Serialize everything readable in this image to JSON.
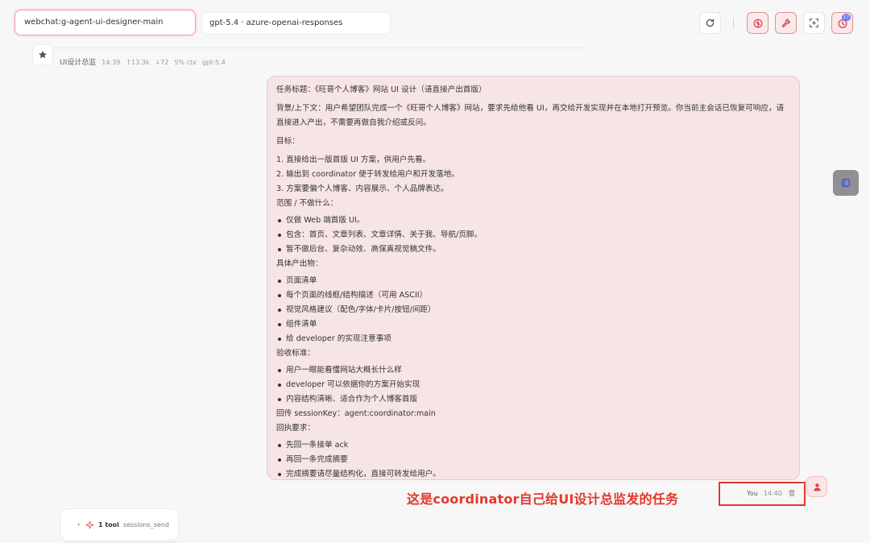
{
  "header": {
    "session_value": "webchat:g-agent-ui-designer-main",
    "model_value": "gpt-5.4 · azure-openai-responses",
    "buttons": {
      "refresh": "refresh-icon",
      "brain": "brain-icon",
      "wrench": "wrench-icon",
      "focus": "focus-icon",
      "history": "history-icon"
    },
    "badge_count": "17"
  },
  "assistant_meta": {
    "name": "UI设计总监",
    "time": "14:39",
    "tokens_up": "↑13.3k",
    "tokens_down": "↓72",
    "ctx": "5% ctx",
    "model": "gpt-5.4"
  },
  "message": {
    "task_title": "任务标题：《旺哥个人博客》网站 UI 设计（请直接产出首版）",
    "background": "背景/上下文：用户希望团队完成一个《旺哥个人博客》网站，要求先给他看 UI，再交给开发实现并在本地打开预览。你当前主会话已恢复可响应，请直接进入产出，不需要再做自我介绍或反问。",
    "goals_heading": "目标：",
    "goals": [
      "1. 直接给出一版首版 UI 方案，供用户先看。",
      "2. 输出到 coordinator 便于转发给用户和开发落地。",
      "3. 方案要偏个人博客、内容展示、个人品牌表达。"
    ],
    "scope_heading": "范围 / 不做什么：",
    "scope": [
      "仅做 Web 端首版 UI。",
      "包含：首页、文章列表、文章详情、关于我、导航/页脚。",
      "暂不做后台、复杂动效、高保真视觉稿文件。"
    ],
    "deliverables_heading": "具体产出物：",
    "deliverables": [
      "页面清单",
      "每个页面的线框/结构描述（可用 ASCII）",
      "视觉风格建议（配色/字体/卡片/按钮/间距）",
      "组件清单",
      "给 developer 的实现注意事项"
    ],
    "acceptance_heading": "验收标准：",
    "acceptance": [
      "用户一眼能看懂网站大概长什么样",
      "developer 可以依据你的方案开始实现",
      "内容结构清晰、适合作为个人博客首版"
    ],
    "session_key": "回传 sessionKey：agent:coordinator:main",
    "reply_heading": "回执要求：",
    "reply": [
      "先回一条接单 ack",
      "再回一条完成摘要",
      "完成摘要请尽量结构化，直接可转发给用户。"
    ]
  },
  "user_meta": {
    "sender": "You",
    "time": "14:40"
  },
  "annotation": "这是coordinator自己给UI设计总监发的任务",
  "tool_call": {
    "count": "1 tool",
    "name": "sessions_send"
  },
  "colors": {
    "accent": "#d9434e",
    "annotation": "#e2382b",
    "bubble_bg": "#f7e4e6"
  }
}
